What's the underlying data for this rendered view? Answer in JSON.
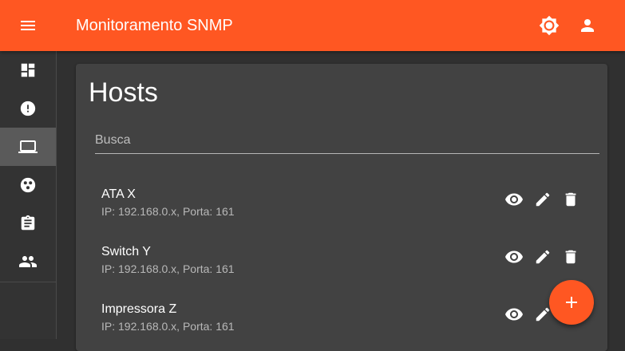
{
  "app": {
    "title": "Monitoramento SNMP",
    "accent_color": "#ff5722",
    "icons": {
      "menu": "menu-icon",
      "theme": "brightness-icon",
      "account": "person-icon"
    }
  },
  "sidebar": {
    "items": [
      {
        "icon": "dashboard-icon",
        "active": false
      },
      {
        "icon": "alert-circle-icon",
        "active": false
      },
      {
        "icon": "laptop-icon",
        "active": true
      },
      {
        "icon": "hub-icon",
        "active": false
      },
      {
        "icon": "clipboard-icon",
        "active": false
      },
      {
        "icon": "people-icon",
        "active": false
      }
    ]
  },
  "main": {
    "page_title": "Hosts",
    "search": {
      "placeholder": "Busca",
      "value": ""
    },
    "hosts": [
      {
        "name": "ATA X",
        "details": "IP: 192.168.0.x, Porta: 161",
        "actions": [
          "view-icon",
          "edit-icon",
          "delete-icon"
        ]
      },
      {
        "name": "Switch Y",
        "details": "IP: 192.168.0.x, Porta: 161",
        "actions": [
          "view-icon",
          "edit-icon",
          "delete-icon"
        ]
      },
      {
        "name": "Impressora Z",
        "details": "IP: 192.168.0.x, Porta: 161",
        "actions": [
          "view-icon",
          "edit-icon"
        ]
      }
    ],
    "fab_icon": "plus-icon"
  }
}
